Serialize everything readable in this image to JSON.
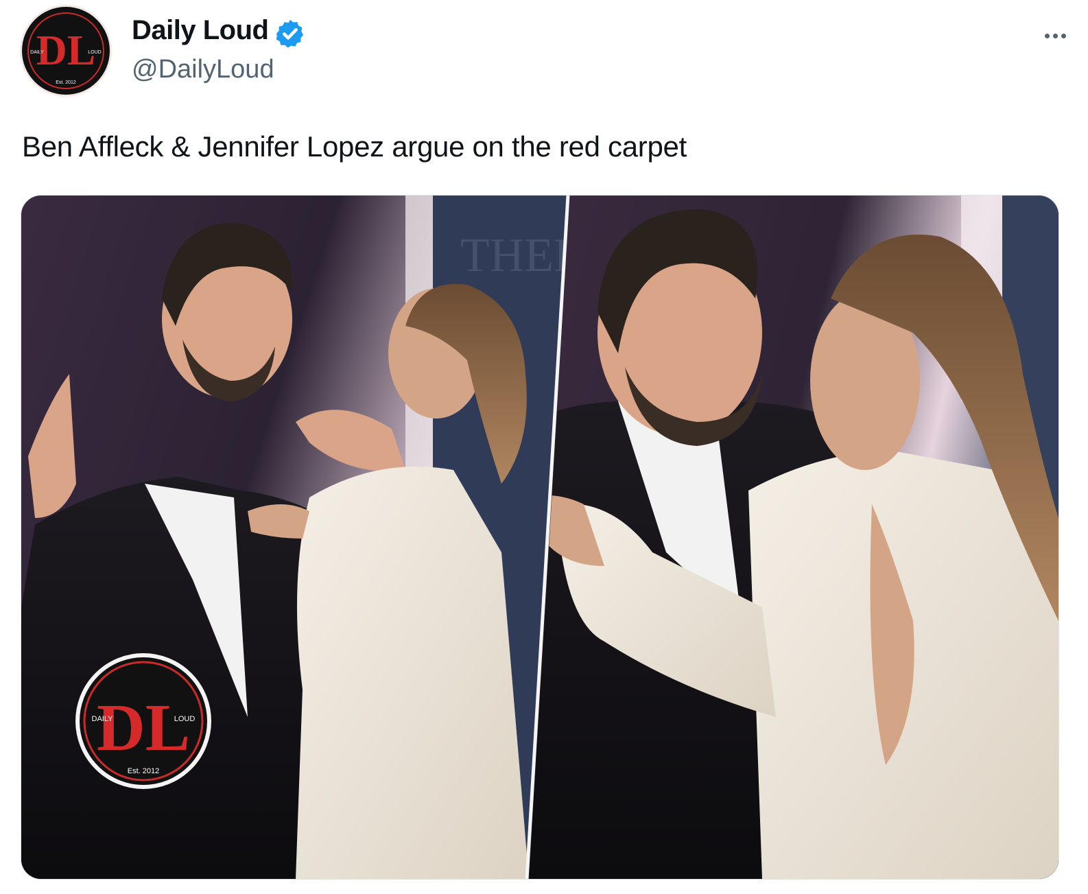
{
  "account": {
    "display_name": "Daily Loud",
    "handle": "@DailyLoud",
    "verified": true,
    "avatar_icon": "daily-loud-logo-icon"
  },
  "tweet": {
    "text": "Ben Affleck & Jennifer Lopez argue on the red carpet",
    "more_icon": "more-options-icon"
  },
  "media": {
    "panels": 2,
    "watermark": {
      "monogram": "DL",
      "left_text": "DAILY",
      "right_text": "LOUD",
      "est_text": "Est. 2012"
    },
    "avatar_logo": {
      "monogram": "DL",
      "left_text": "DAILY",
      "right_text": "LOUD",
      "est_text": "Est. 2012"
    }
  },
  "colors": {
    "brand_red": "#d62a2a",
    "verified_blue": "#1d9bf0",
    "text_primary": "#0f1419",
    "text_secondary": "#536471"
  }
}
